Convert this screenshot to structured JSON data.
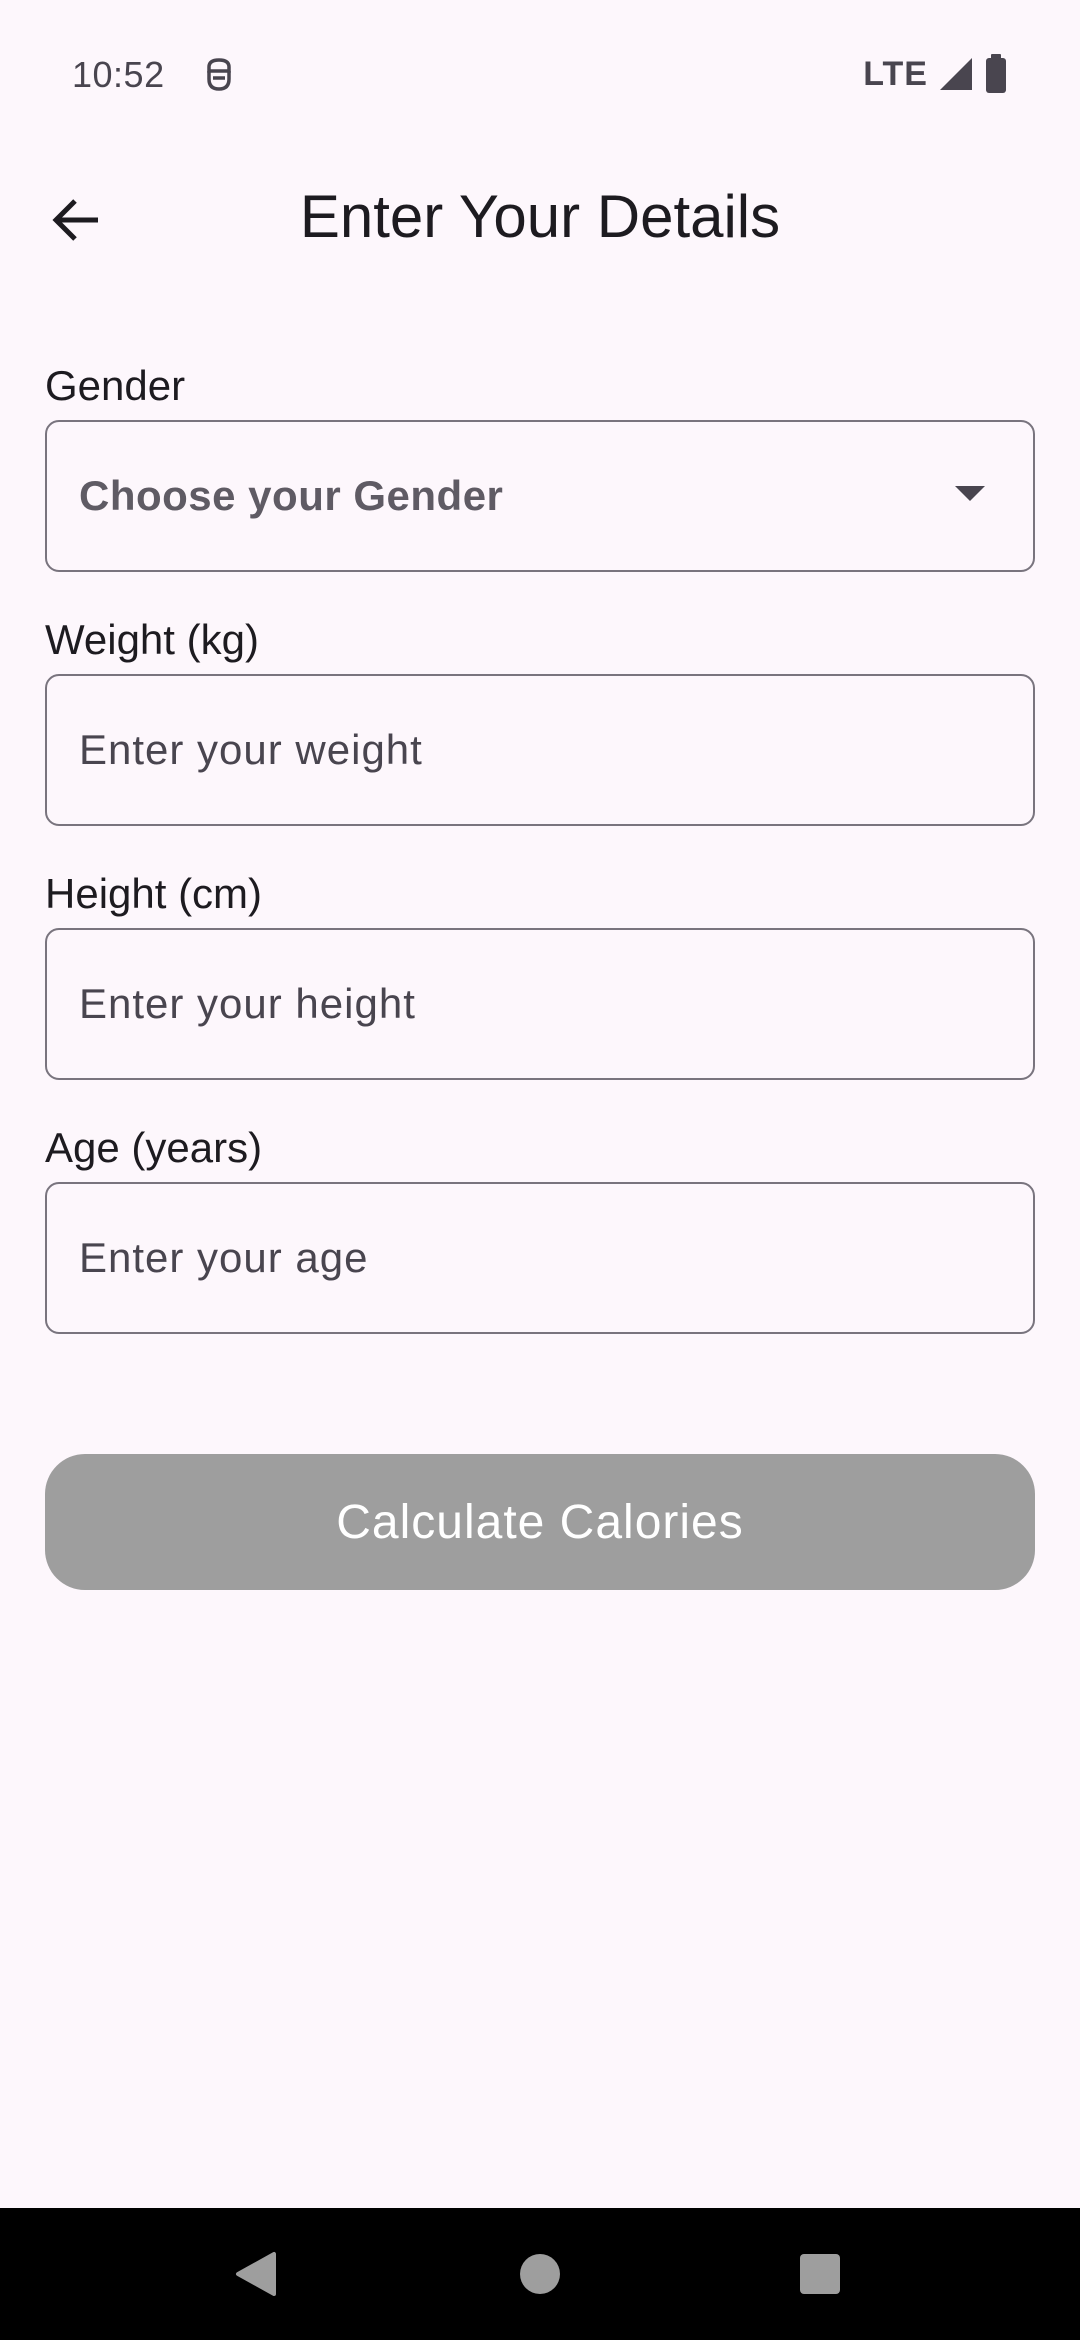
{
  "status_bar": {
    "time": "10:52",
    "network": "LTE",
    "icons": [
      "notification-icon",
      "signal-icon",
      "battery-icon"
    ]
  },
  "app_bar": {
    "title": "Enter Your Details",
    "back_icon": "arrow-back-icon"
  },
  "form": {
    "gender": {
      "label": "Gender",
      "selected": "Choose your Gender"
    },
    "weight": {
      "label": "Weight (kg)",
      "value": "",
      "placeholder": "Enter your weight"
    },
    "height": {
      "label": "Height (cm)",
      "value": "",
      "placeholder": "Enter your height"
    },
    "age": {
      "label": "Age (years)",
      "value": "",
      "placeholder": "Enter your age"
    },
    "submit_label": "Calculate Calories"
  },
  "nav_bar": {
    "icons": [
      "nav-back-icon",
      "nav-home-icon",
      "nav-recents-icon"
    ]
  },
  "colors": {
    "background": "#fdf7fc",
    "button_disabled": "#9e9e9e",
    "outline": "#79747e",
    "text": "#1d1b20"
  }
}
